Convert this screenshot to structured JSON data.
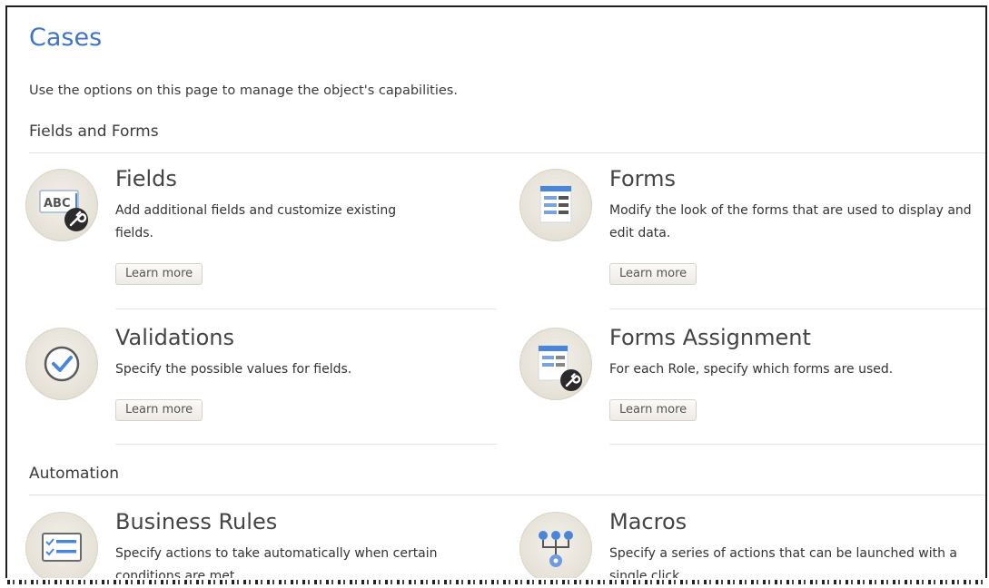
{
  "page": {
    "title": "Cases",
    "intro": "Use the options on this page to manage the object's capabilities."
  },
  "sections": {
    "fields_and_forms": {
      "heading": "Fields and Forms",
      "cards": {
        "fields": {
          "title": "Fields",
          "description": "Add additional fields and customize existing fields.",
          "learn_more": "Learn more",
          "icon": "abc-wrench-icon"
        },
        "forms": {
          "title": "Forms",
          "description": "Modify the look of the forms that are used to display and edit data.",
          "learn_more": "Learn more",
          "icon": "form-layout-icon"
        },
        "validations": {
          "title": "Validations",
          "description": "Specify the possible values for fields.",
          "learn_more": "Learn more",
          "icon": "checkmark-icon"
        },
        "forms_assignment": {
          "title": "Forms Assignment",
          "description": "For each Role, specify which forms are used.",
          "learn_more": "Learn more",
          "icon": "form-wrench-icon"
        }
      }
    },
    "automation": {
      "heading": "Automation",
      "cards": {
        "business_rules": {
          "title": "Business Rules",
          "description": "Specify actions to take automatically when certain conditions are met.",
          "icon": "checklist-icon"
        },
        "macros": {
          "title": "Macros",
          "description": "Specify a series of actions that can be launched with a single click.",
          "icon": "macro-flow-icon"
        }
      }
    }
  },
  "colors": {
    "title_blue": "#3f76c4",
    "icon_bg": "#e7e3d9",
    "icon_blue": "#4a86d8",
    "icon_dark": "#2b2b2b"
  }
}
